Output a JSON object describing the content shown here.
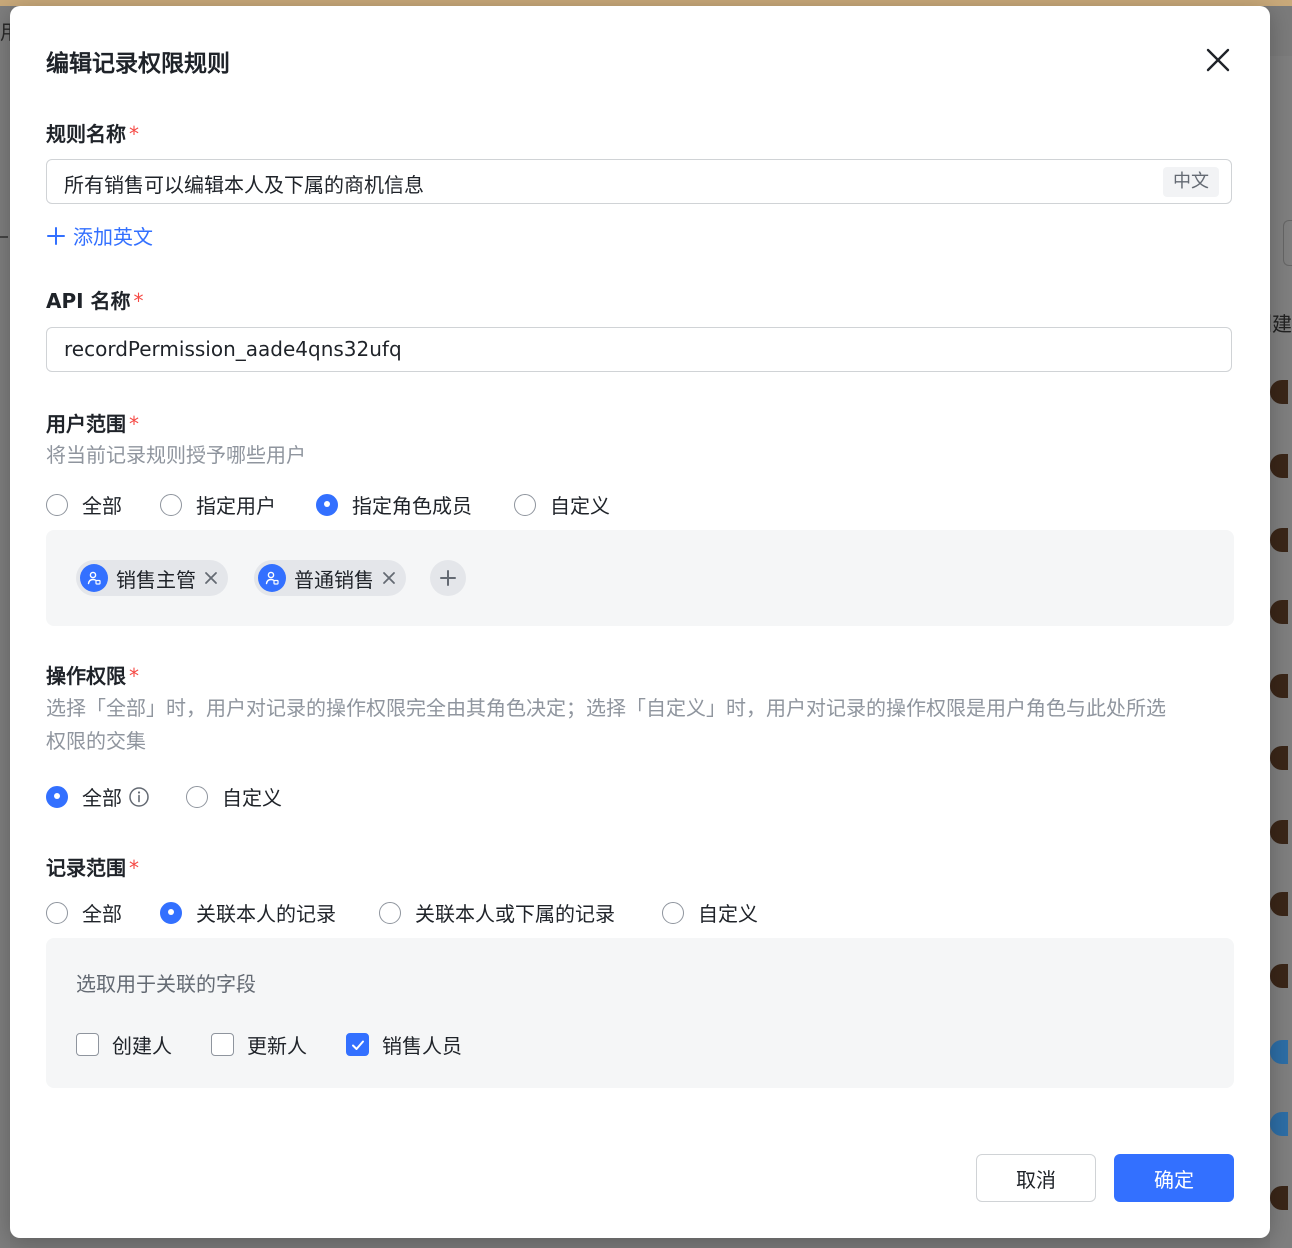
{
  "background": {
    "left_char": "用",
    "right_text": "创建"
  },
  "modal": {
    "title": "编辑记录权限规则",
    "close_icon": "close-icon"
  },
  "rule_name": {
    "label": "规则名称",
    "required_mark": "*",
    "value": "所有销售可以编辑本人及下属的商机信息",
    "lang_tag": "中文",
    "add_english": "添加英文"
  },
  "api_name": {
    "label": "API 名称",
    "required_mark": "*",
    "value": "recordPermission_aade4qns32ufq"
  },
  "user_scope": {
    "label": "用户范围",
    "required_mark": "*",
    "hint": "将当前记录规则授予哪些用户",
    "options": [
      "全部",
      "指定用户",
      "指定角色成员",
      "自定义"
    ],
    "selected": "指定角色成员",
    "roles": [
      "销售主管",
      "普通销售"
    ]
  },
  "operation": {
    "label": "操作权限",
    "required_mark": "*",
    "hint_line1": "选择「全部」时，用户对记录的操作权限完全由其角色决定；选择「自定义」时，用户对记录的操作权限是用户角色与此处所选",
    "hint_line2": "权限的交集",
    "options": [
      "全部",
      "自定义"
    ],
    "selected": "全部"
  },
  "record_scope": {
    "label": "记录范围",
    "required_mark": "*",
    "options": [
      "全部",
      "关联本人的记录",
      "关联本人或下属的记录",
      "自定义"
    ],
    "selected": "关联本人的记录",
    "field_title": "选取用于关联的字段",
    "fields": [
      {
        "label": "创建人",
        "checked": false
      },
      {
        "label": "更新人",
        "checked": false
      },
      {
        "label": "销售人员",
        "checked": true
      }
    ]
  },
  "footer": {
    "cancel": "取消",
    "confirm": "确定"
  },
  "colors": {
    "primary": "#3370ff",
    "required": "#f54a45",
    "hint": "#8f959e"
  }
}
